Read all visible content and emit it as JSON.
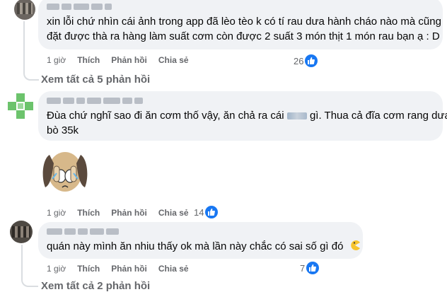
{
  "comments": [
    {
      "text_line1": "xin lỗi chứ nhìn cái ảnh trong app đã lèo tèo k có tí rau dưa hành cháo nào mà cũng",
      "text_line2": "đặt được thà ra hàng làm suất cơm còn được 2 suất 3 món thịt 1 món rau bạn ạ : D",
      "time": "1 giờ",
      "like_label": "Thích",
      "reply_label": "Phản hồi",
      "share_label": "Chia sẻ",
      "reaction_count": "26",
      "more_replies": "Xem tất cả 5 phản hồi"
    },
    {
      "text_line1_a": "Đùa chứ nghĩ sao đi ăn cơm thố vậy, ăn chả ra cái",
      "text_line1_b": "gì. Thua cả đĩa cơm rang dưa",
      "text_line2": "bò 35k",
      "time": "1 giờ",
      "like_label": "Thích",
      "reply_label": "Phản hồi",
      "share_label": "Chia sẻ",
      "reaction_count": "14"
    },
    {
      "text_line1": "quán này mình ăn nhiu thấy ok mà lần này chắc có sai số gì đó",
      "time": "1 giờ",
      "like_label": "Thích",
      "reply_label": "Phản hồi",
      "share_label": "Chia sẻ",
      "reaction_count": "7",
      "more_replies": "Xem tất cả 2 phản hồi"
    }
  ],
  "icons": {
    "reaction": "like-thumb-icon",
    "sticker": "crying-dog-sticker",
    "emoji": "pacman-emoji"
  },
  "colors": {
    "bubble": "#f0f2f5",
    "action_text": "#65676b",
    "like_blue": "#1877f2"
  }
}
